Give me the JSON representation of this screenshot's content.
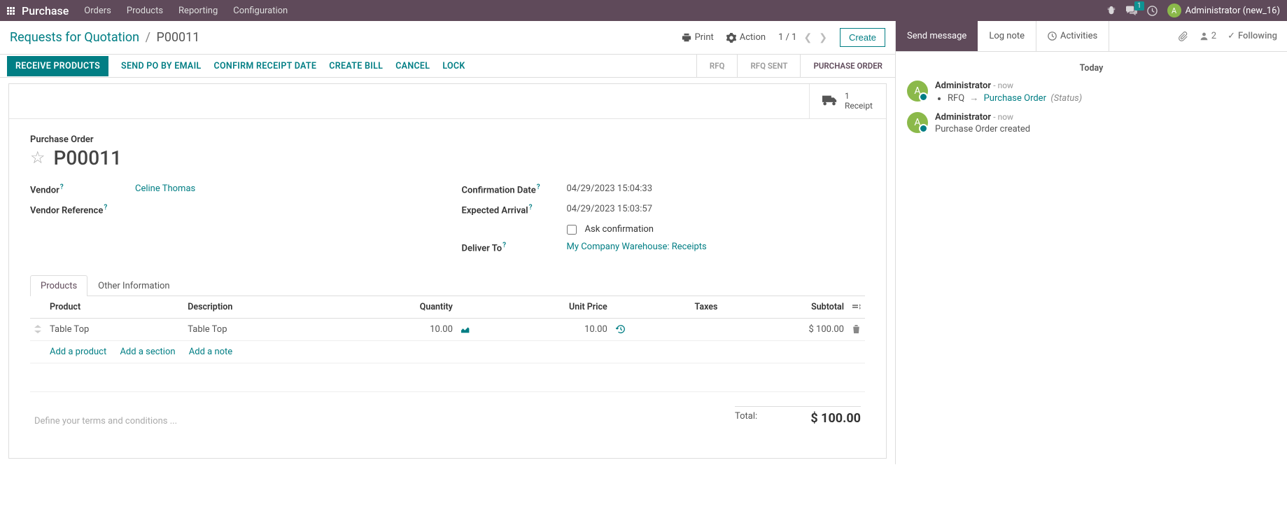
{
  "colors": {
    "primary": "#017e84",
    "brand": "#5f4a5a",
    "success": "#3a9d3a"
  },
  "nav": {
    "app_name": "Purchase",
    "items": [
      "Orders",
      "Products",
      "Reporting",
      "Configuration"
    ],
    "chat_badge": "1",
    "user_initial": "A",
    "user_name": "Administrator (new_16)"
  },
  "breadcrumb": {
    "root": "Requests for Quotation",
    "current": "P00011",
    "print": "Print",
    "action": "Action",
    "pager": "1 / 1",
    "create": "Create"
  },
  "statusbar": {
    "buttons": {
      "receive": "RECEIVE PRODUCTS",
      "send_po": "SEND PO BY EMAIL",
      "confirm_date": "CONFIRM RECEIPT DATE",
      "create_bill": "CREATE BILL",
      "cancel": "CANCEL",
      "lock": "LOCK"
    },
    "stages": {
      "rfq": "RFQ",
      "rfq_sent": "RFQ SENT",
      "po": "PURCHASE ORDER"
    }
  },
  "stat_button": {
    "count": "1",
    "label": "Receipt"
  },
  "form": {
    "title_label": "Purchase Order",
    "doc_name": "P00011",
    "vendor_label": "Vendor",
    "vendor_value": "Celine Thomas",
    "vendor_ref_label": "Vendor Reference",
    "confirmation_label": "Confirmation Date",
    "confirmation_value": "04/29/2023 15:04:33",
    "arrival_label": "Expected Arrival",
    "arrival_value": "04/29/2023 15:03:57",
    "ask_confirmation_label": "Ask confirmation",
    "deliver_to_label": "Deliver To",
    "deliver_to_value": "My Company Warehouse: Receipts"
  },
  "tabs": {
    "products": "Products",
    "other": "Other Information"
  },
  "table": {
    "headers": {
      "product": "Product",
      "description": "Description",
      "quantity": "Quantity",
      "unit_price": "Unit Price",
      "taxes": "Taxes",
      "subtotal": "Subtotal"
    },
    "rows": [
      {
        "product": "Table Top",
        "description": "Table Top",
        "quantity": "10.00",
        "unit_price": "10.00",
        "taxes": "",
        "subtotal": "$ 100.00"
      }
    ],
    "add_product": "Add a product",
    "add_section": "Add a section",
    "add_note": "Add a note"
  },
  "footer": {
    "terms_placeholder": "Define your terms and conditions ...",
    "total_label": "Total:",
    "total_value": "$ 100.00"
  },
  "chatter": {
    "send_message": "Send message",
    "log_note": "Log note",
    "activities": "Activities",
    "followers_count": "2",
    "following": "Following",
    "today": "Today",
    "items": [
      {
        "author": "Administrator",
        "time": "now",
        "type": "track",
        "field": "RFQ",
        "new_value": "Purchase Order",
        "suffix": "(Status)"
      },
      {
        "author": "Administrator",
        "time": "now",
        "type": "message",
        "body": "Purchase Order created"
      }
    ]
  }
}
